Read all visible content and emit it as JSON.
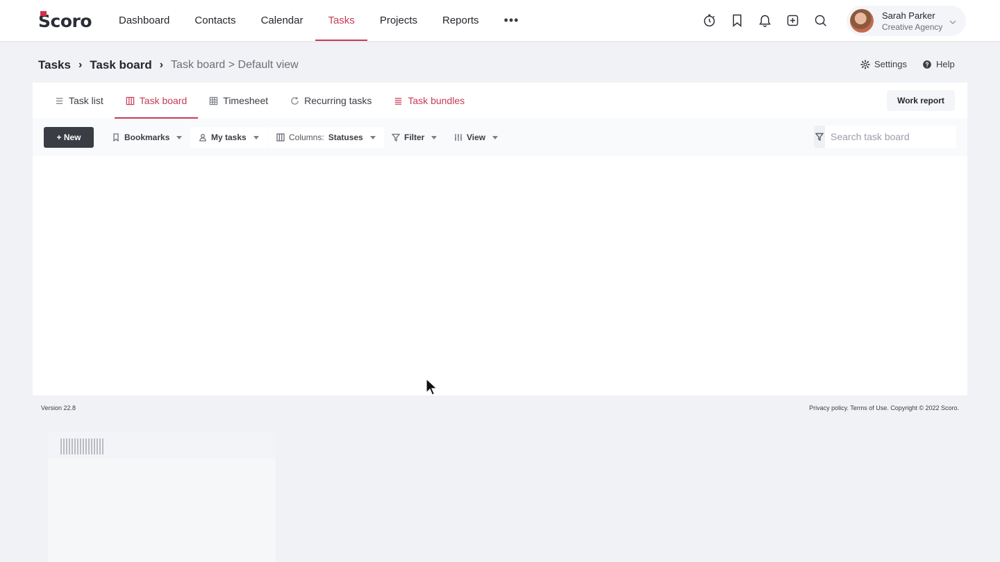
{
  "brand": {
    "logo_text": "Scoro",
    "accent": "#c63a55",
    "logo_mark_color": "#d3324a"
  },
  "nav": {
    "items": [
      {
        "label": "Dashboard",
        "active": false
      },
      {
        "label": "Contacts",
        "active": false
      },
      {
        "label": "Calendar",
        "active": false
      },
      {
        "label": "Tasks",
        "active": true
      },
      {
        "label": "Projects",
        "active": false
      },
      {
        "label": "Reports",
        "active": false
      }
    ],
    "more": "•••",
    "icons": [
      "timer-icon",
      "bookmark-icon",
      "bell-icon",
      "add-icon",
      "search-icon"
    ]
  },
  "user": {
    "name": "Sarah Parker",
    "organization": "Creative Agency"
  },
  "breadcrumb": {
    "root": "Tasks",
    "sep": "›",
    "current": "Task board",
    "view": "Task board > Default view"
  },
  "page_actions": {
    "settings": "Settings",
    "help": "Help"
  },
  "tabs": [
    {
      "label": "Task list",
      "icon": "list-icon"
    },
    {
      "label": "Task board",
      "icon": "board-icon"
    },
    {
      "label": "Timesheet",
      "icon": "grid-icon"
    },
    {
      "label": "Recurring tasks",
      "icon": "refresh-icon"
    },
    {
      "label": "Task bundles",
      "icon": "bundle-icon"
    }
  ],
  "work_report": "Work report",
  "toolbar": {
    "new_label": "+ New",
    "bookmarks": "Bookmarks",
    "my_tasks": "My tasks",
    "columns_prefix": "Columns:",
    "columns_value": "Statuses",
    "filter": "Filter",
    "view": "View",
    "search_placeholder": "Search task board"
  },
  "footer": {
    "version": "Version 22.8",
    "legal": "Privacy policy. Terms of Use. Copyright © 2022 Scoro."
  }
}
